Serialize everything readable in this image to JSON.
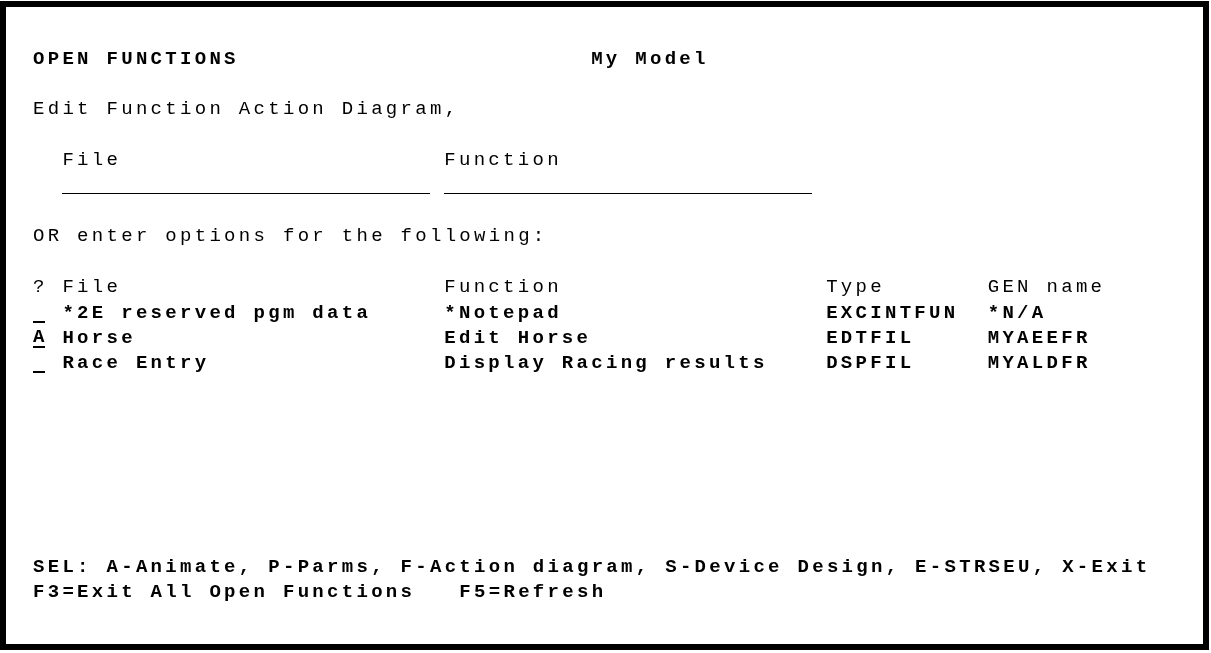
{
  "screen": {
    "title": "OPEN FUNCTIONS",
    "model": "My Model"
  },
  "prompt": "Edit Function Action Diagram,",
  "entry_fields": [
    {
      "label": "File"
    },
    {
      "label": "Function"
    }
  ],
  "list_prompt": "OR enter options for the following:",
  "table": {
    "columns": [
      "?",
      "File",
      "Function",
      "Type",
      "GEN name"
    ],
    "rows": [
      {
        "file": "*2E reserved pgm data",
        "function": "*Notepad",
        "type": "EXCINTFUN",
        "gen_name": "*N/A"
      },
      {
        "option": "A",
        "file": "Horse",
        "function": "Edit Horse",
        "type": "EDTFIL",
        "gen_name": "MYAEEFR"
      },
      {
        "file": "Race Entry",
        "function": "Display Racing results",
        "type": "DSPFIL",
        "gen_name": "MYALDFR"
      }
    ]
  },
  "footer": {
    "selection_help": "SEL: A-Animate, P-Parms, F-Action diagram, S-Device Design, E-STRSEU, X-Exit",
    "function_keys": [
      "F3=Exit All Open Functions",
      "F5=Refresh"
    ]
  }
}
